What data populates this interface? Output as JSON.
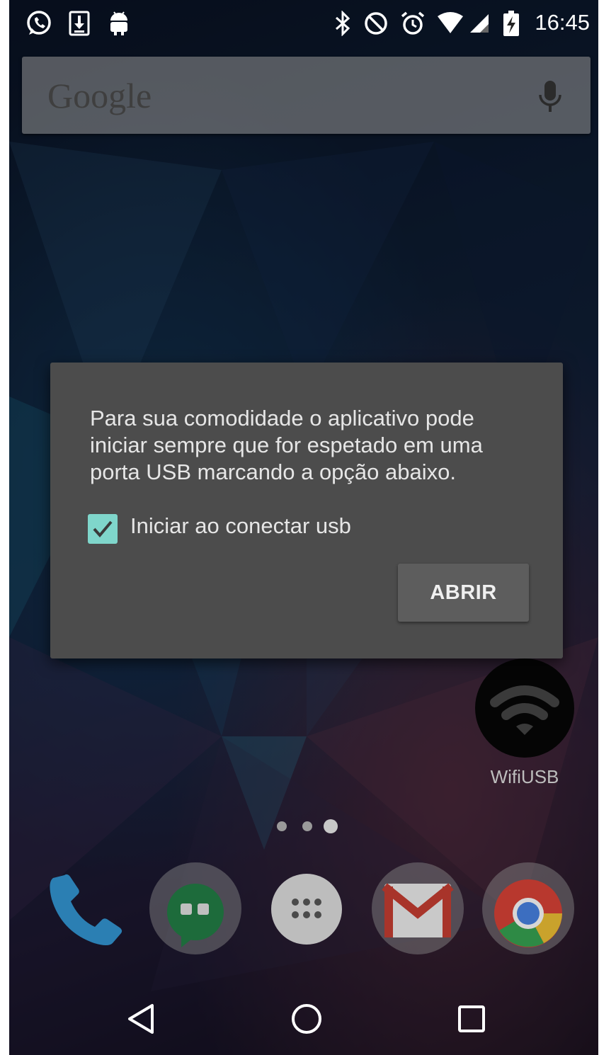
{
  "status_bar": {
    "time": "16:45",
    "left_icons": [
      "whatsapp-icon",
      "download-icon",
      "android-icon"
    ],
    "right_icons": [
      "bluetooth-icon",
      "do-not-disturb-icon",
      "alarm-icon",
      "wifi-icon",
      "signal-icon",
      "battery-charging-icon"
    ]
  },
  "search": {
    "logo": "Google",
    "mic_icon": "microphone-icon"
  },
  "dialog": {
    "message": "Para sua comodidade o aplicativo pode iniciar sempre que for espetado em uma porta USB marcando a opção abaixo.",
    "checkbox_label": "Iniciar ao conectar usb",
    "checkbox_checked": true,
    "button_label": "ABRIR",
    "accent_color": "#7fd6cb"
  },
  "home_app": {
    "label": "WifiUSB",
    "icon": "wifi-icon"
  },
  "page_indicator": {
    "count": 3,
    "active_index": 2
  },
  "dock": {
    "apps": [
      "phone-icon",
      "hangouts-icon",
      "app-drawer-icon",
      "gmail-icon",
      "chrome-icon"
    ]
  },
  "nav_bar": {
    "buttons": [
      "back-icon",
      "home-icon",
      "recents-icon"
    ]
  }
}
